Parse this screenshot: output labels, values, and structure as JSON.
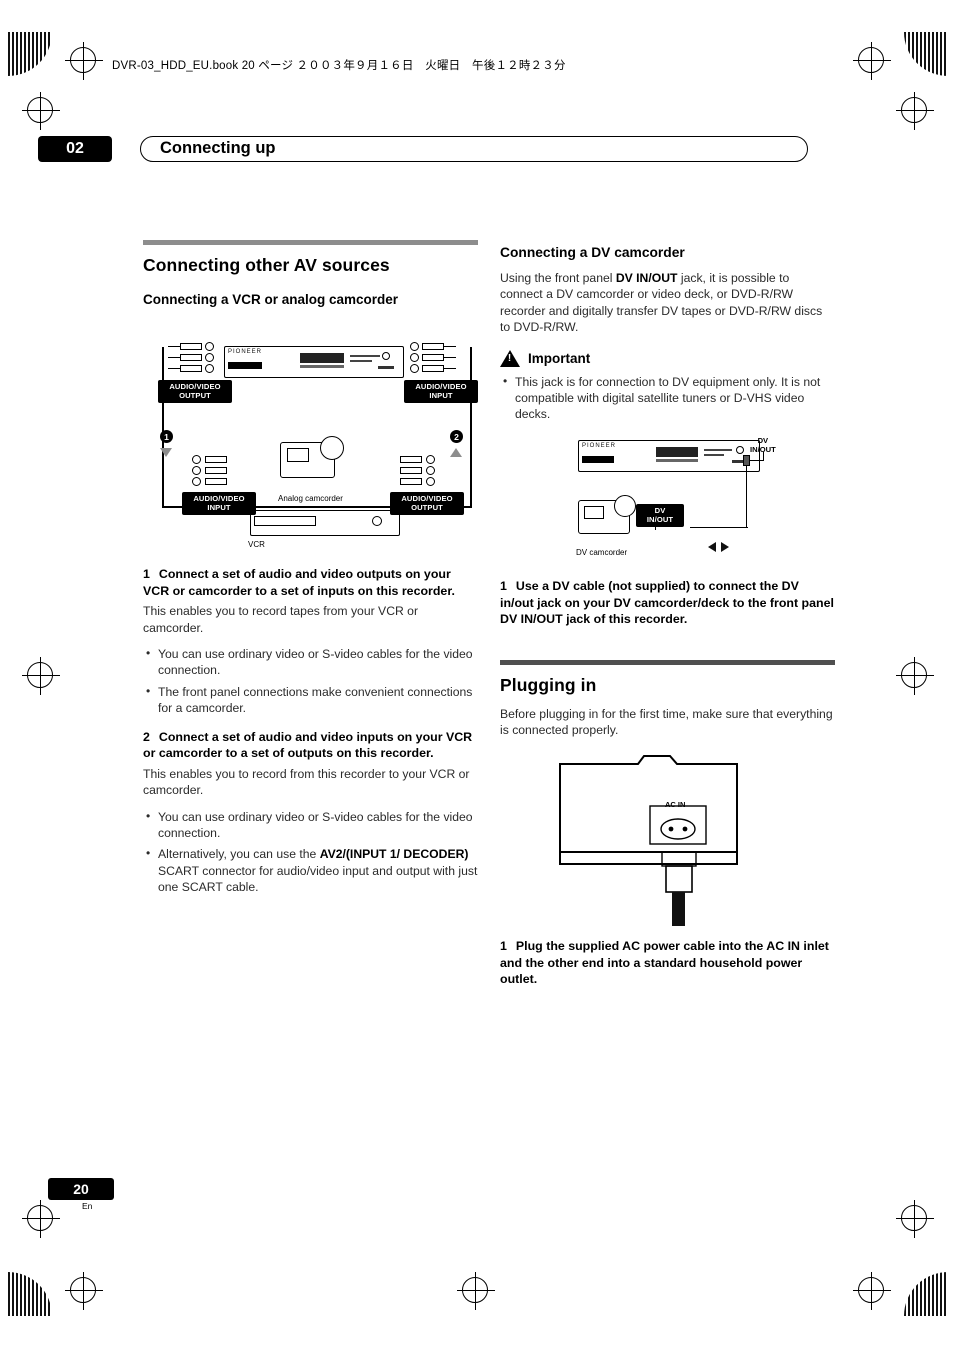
{
  "header": {
    "filename_line": "DVR-03_HDD_EU.book 20 ページ ２００３年９月１６日　火曜日　午後１２時２３分"
  },
  "chapter": {
    "number": "02",
    "title": "Connecting up"
  },
  "left_column": {
    "section_title": "Connecting other AV sources",
    "subsection_title": "Connecting a VCR or analog camcorder",
    "figure": {
      "top_left_label": "AUDIO/VIDEO\nOUTPUT",
      "top_left_label_line1": "AUDIO/VIDEO",
      "top_left_label_line2": "OUTPUT",
      "top_right_label_line1": "AUDIO/VIDEO",
      "top_right_label_line2": "INPUT",
      "bottom_left_label_line1": "AUDIO/VIDEO",
      "bottom_left_label_line2": "INPUT",
      "bottom_right_label_line1": "AUDIO/VIDEO",
      "bottom_right_label_line2": "OUTPUT",
      "callout_1": "1",
      "callout_2": "2",
      "camcorder_caption": "Analog camcorder",
      "vcr_caption": "VCR",
      "brand": "PIONEER"
    },
    "step1_num": "1",
    "step1_text": "Connect a set of audio and video outputs on your VCR or camcorder to a set of inputs on this recorder.",
    "step1_body": "This enables you to record tapes from your VCR or camcorder.",
    "step1_bullets": [
      "You can use ordinary video or S-video cables for the video connection.",
      "The front panel connections make convenient connections for a camcorder."
    ],
    "step2_num": "2",
    "step2_text": "Connect a set of audio and video inputs on your VCR or camcorder to a set of outputs on this recorder.",
    "step2_body": "This enables you to record from this recorder to your VCR or camcorder.",
    "step2_bullet1": "You can use ordinary video or S-video cables for the video connection.",
    "step2_bullet2_pre": "Alternatively, you can use the ",
    "step2_bullet2_bold": "AV2/(INPUT 1/ DECODER)",
    "step2_bullet2_post": " SCART connector for audio/video input and output with just one SCART cable."
  },
  "right_column": {
    "dv_title": "Connecting a DV camcorder",
    "dv_body_pre": "Using the front panel ",
    "dv_body_bold": "DV IN/OUT",
    "dv_body_post": " jack, it is possible to connect a DV camcorder or video deck, or DVD-R/RW recorder and digitally transfer DV tapes or DVD-R/RW discs to DVD-R/RW.",
    "important_label": "Important",
    "important_bullet": "This jack is for connection to DV equipment only. It is not compatible with digital satellite tuners or D-VHS video decks.",
    "dv_figure": {
      "jack_label_line1": "DV",
      "jack_label_line2": "IN/OUT",
      "box_label_line1": "DV",
      "box_label_line2": "IN/OUT",
      "camcorder_caption": "DV camcorder"
    },
    "dv_step_num": "1",
    "dv_step_text": "Use a DV cable (not supplied) to connect the DV in/out jack on your DV camcorder/deck to the front panel DV IN/OUT jack of this recorder.",
    "plug_title": "Plugging in",
    "plug_body": "Before plugging in for the first time, make sure that everything is connected properly.",
    "plug_figure": {
      "ac_in_label": "AC IN"
    },
    "plug_step_num": "1",
    "plug_step_text": "Plug the supplied AC power cable into the AC IN inlet and the other end into a standard household power outlet."
  },
  "footer": {
    "page_number": "20",
    "language_code": "En"
  }
}
